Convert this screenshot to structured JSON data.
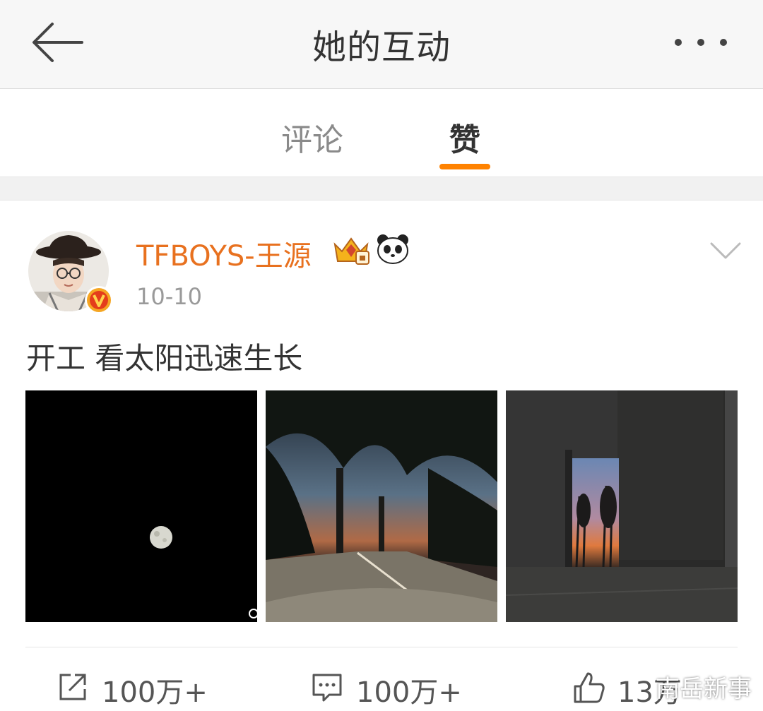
{
  "nav": {
    "title": "她的互动",
    "back_icon": "back-arrow-icon",
    "more_icon": "more-dots-icon"
  },
  "tabs": [
    {
      "label": "评论",
      "active": false
    },
    {
      "label": "赞",
      "active": true
    }
  ],
  "accent_color": "#ff8200",
  "post": {
    "username": "TFBOYS-王源",
    "username_color": "#e8711f",
    "time": "10-10",
    "text": "开工 看太阳迅速生长",
    "badges": [
      "crown-badge-icon",
      "panda-badge-icon"
    ],
    "verified_icon": "verified-v-icon",
    "photos": [
      "moon-photo",
      "dusk-road-photo",
      "doorway-sunset-photo"
    ],
    "actions": {
      "repost": "100万+",
      "comment": "100万+",
      "like": "13万"
    }
  },
  "watermark": "南岳新事"
}
